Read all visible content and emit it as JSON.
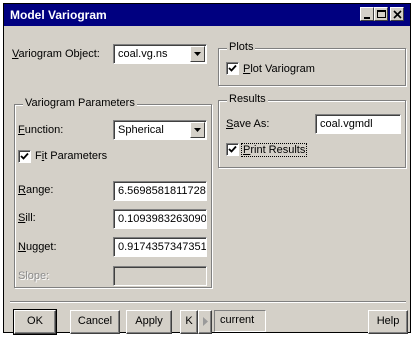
{
  "window": {
    "title": "Model Variogram"
  },
  "variogram_object": {
    "label": "Variogram Object:",
    "value": "coal.vg.ns"
  },
  "variogram_parameters": {
    "title": "Variogram Parameters",
    "function_label": "Function:",
    "function_value": "Spherical",
    "fit_parameters_label": "Fit Parameters",
    "fit_parameters_checked": true,
    "range_label": "Range:",
    "range_value": "6.5698581811728",
    "sill_label": "Sill:",
    "sill_value": "0.1093983263090",
    "nugget_label": "Nugget:",
    "nugget_value": "0.9174357347351",
    "slope_label": "Slope:",
    "slope_value": ""
  },
  "plots": {
    "title": "Plots",
    "plot_variogram_label": "Plot Variogram",
    "plot_variogram_checked": true
  },
  "results": {
    "title": "Results",
    "save_as_label": "Save As:",
    "save_as_value": "coal.vgmdl",
    "print_results_label": "Print Results",
    "print_results_checked": true
  },
  "buttons": {
    "ok": "OK",
    "cancel": "Cancel",
    "apply": "Apply",
    "prev": "K",
    "current": "current",
    "help": "Help"
  }
}
